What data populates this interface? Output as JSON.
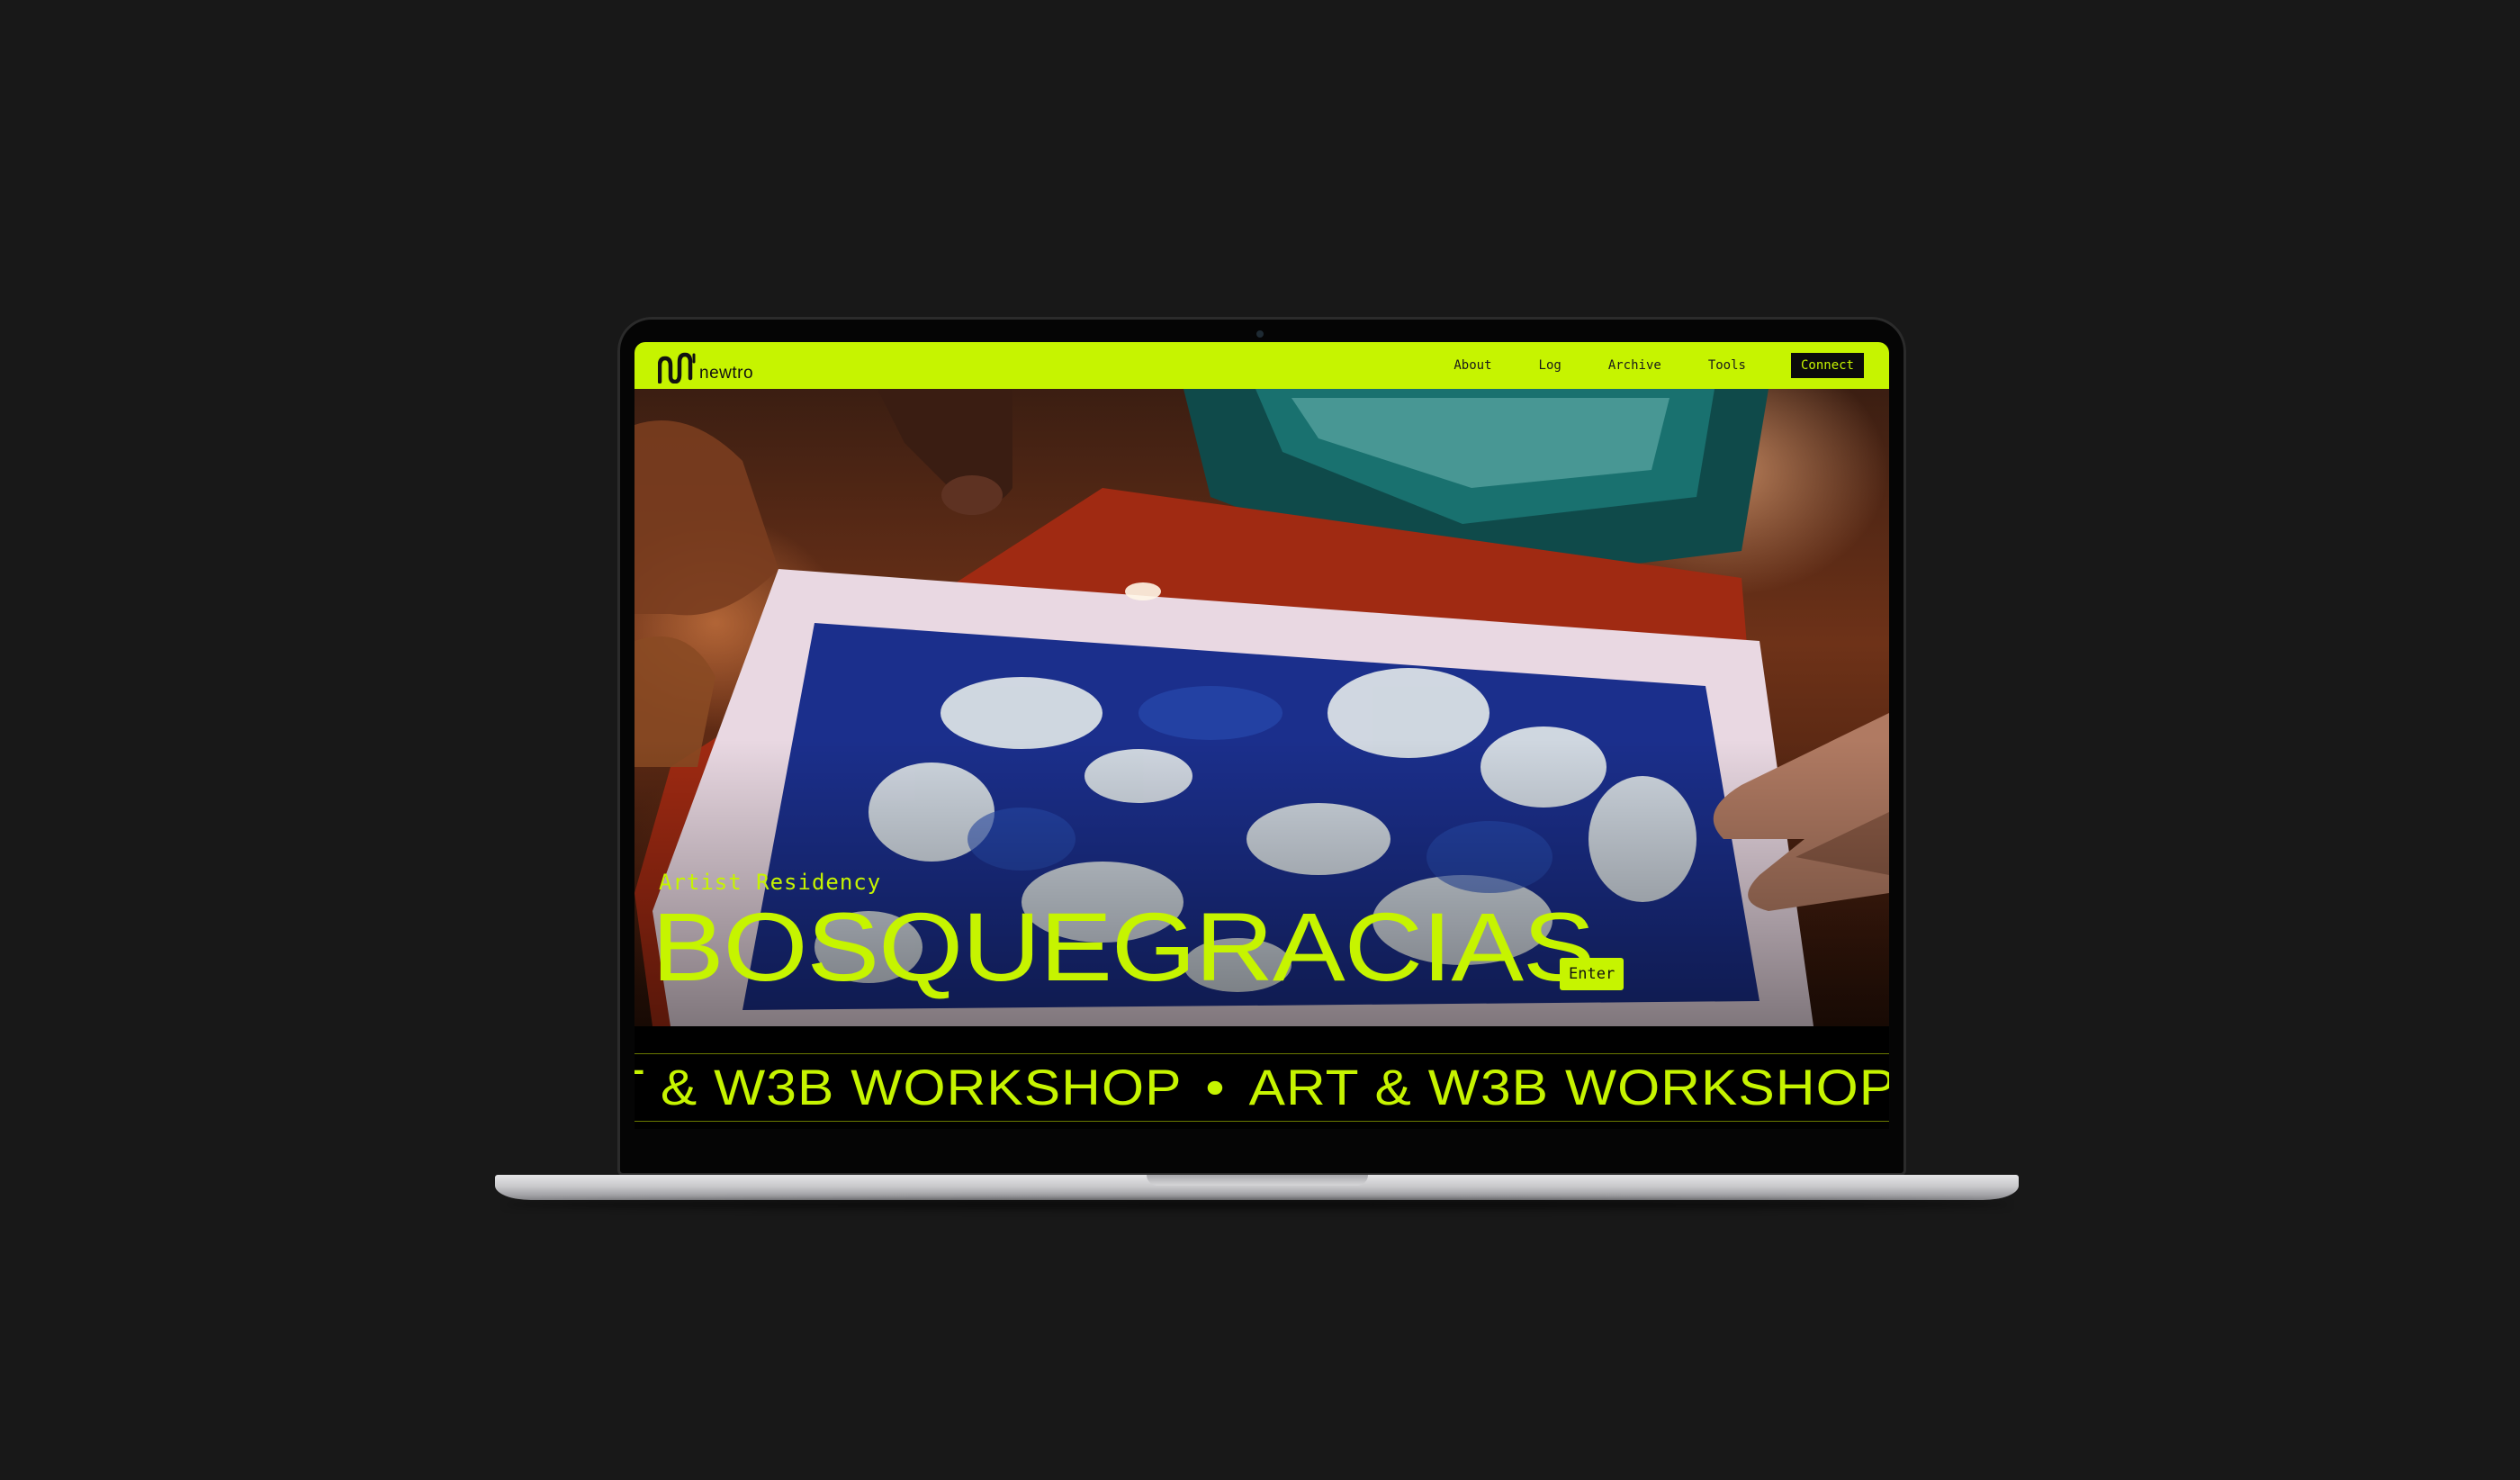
{
  "brand": {
    "logo_icon": "newtro-wave-logo",
    "name": "newtro",
    "accent": "#c6f400"
  },
  "nav": {
    "links": [
      "About",
      "Log",
      "Archive",
      "Tools"
    ],
    "cta": "Connect"
  },
  "hero": {
    "eyebrow": "Artist Residency",
    "title": "BOSQUEGRACIAS",
    "enter": "Enter",
    "image": "photo-hands-cyanotype-print-tray"
  },
  "marquee": {
    "items": [
      "T & W3B WORKSHOP",
      "ART & W3B WORKSHOP"
    ],
    "separator": "•"
  },
  "colors": {
    "background": "#181818",
    "screen": "#000000",
    "accent": "#c6f400"
  }
}
